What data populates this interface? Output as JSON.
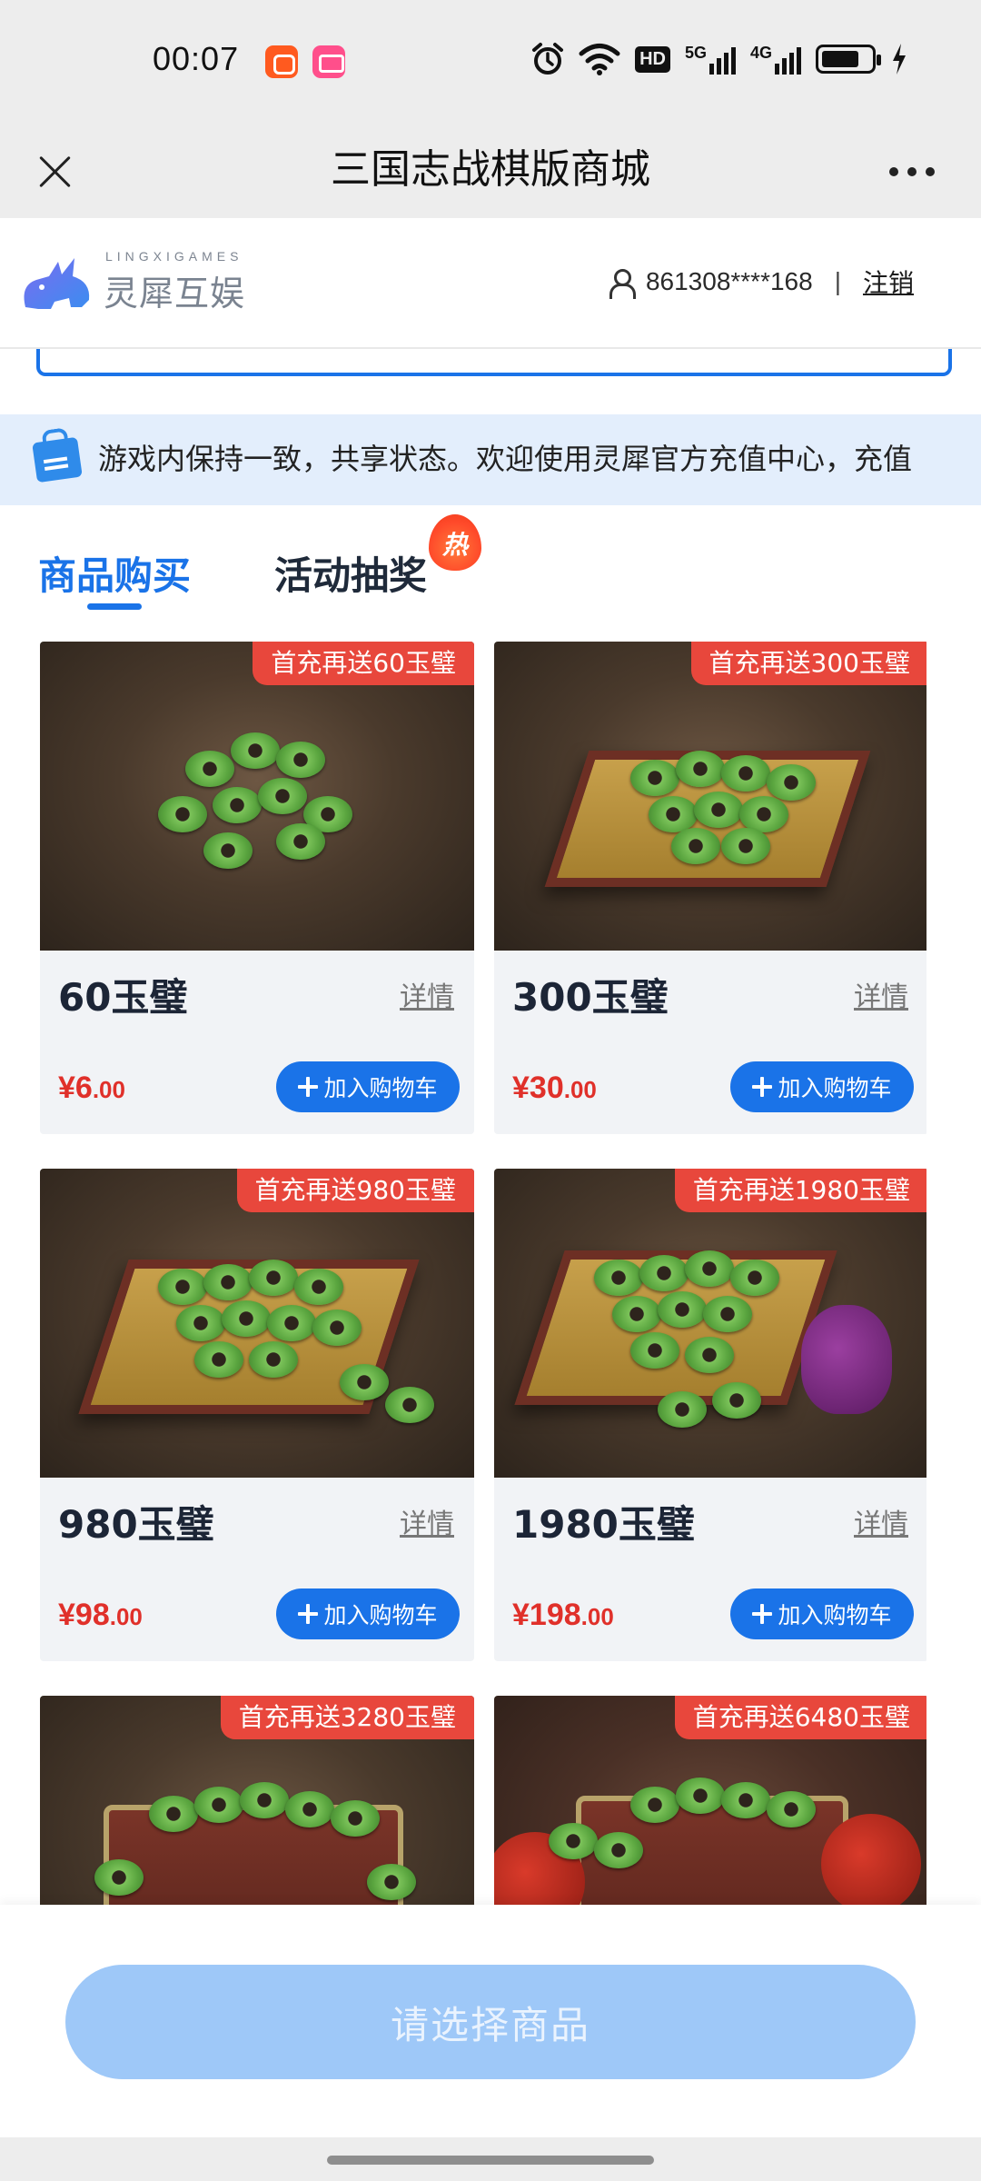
{
  "status_bar": {
    "time": "00:07",
    "icons": [
      "alarm-icon",
      "wifi-icon",
      "hd-icon",
      "5g-signal-icon",
      "4g-signal-icon",
      "battery-icon",
      "charging-icon"
    ],
    "hd_label": "HD",
    "net1": "5G",
    "net2": "4G"
  },
  "titlebar": {
    "title": "三国志战棋版商城"
  },
  "header": {
    "logo_en": "LINGXIGAMES",
    "logo_cn": "灵犀互娱",
    "user_id": "861308****168",
    "separator": "|",
    "logout": "注销"
  },
  "notice": {
    "text": "游戏内保持一致，共享状态。欢迎使用灵犀官方充值中心，充值"
  },
  "tabs": {
    "active": "商品购买",
    "inactive": "活动抽奖",
    "hot": "热"
  },
  "products": [
    {
      "name": "60玉璧",
      "promo": "首充再送60玉璧",
      "price_int": "¥6",
      "price_dec": ".00",
      "detail": "详情",
      "cart": "加入购物车"
    },
    {
      "name": "300玉璧",
      "promo": "首充再送300玉璧",
      "price_int": "¥30",
      "price_dec": ".00",
      "detail": "详情",
      "cart": "加入购物车"
    },
    {
      "name": "980玉璧",
      "promo": "首充再送980玉璧",
      "price_int": "¥98",
      "price_dec": ".00",
      "detail": "详情",
      "cart": "加入购物车"
    },
    {
      "name": "1980玉璧",
      "promo": "首充再送1980玉璧",
      "price_int": "¥198",
      "price_dec": ".00",
      "detail": "详情",
      "cart": "加入购物车"
    },
    {
      "promo": "首充再送3280玉璧"
    },
    {
      "promo": "首充再送6480玉璧"
    }
  ],
  "bottom": {
    "select_button": "请选择商品"
  },
  "colors": {
    "accent": "#1a73e8",
    "price": "#e0302a",
    "promo": "#e8473c",
    "disabled_button": "#9ec8f8"
  }
}
